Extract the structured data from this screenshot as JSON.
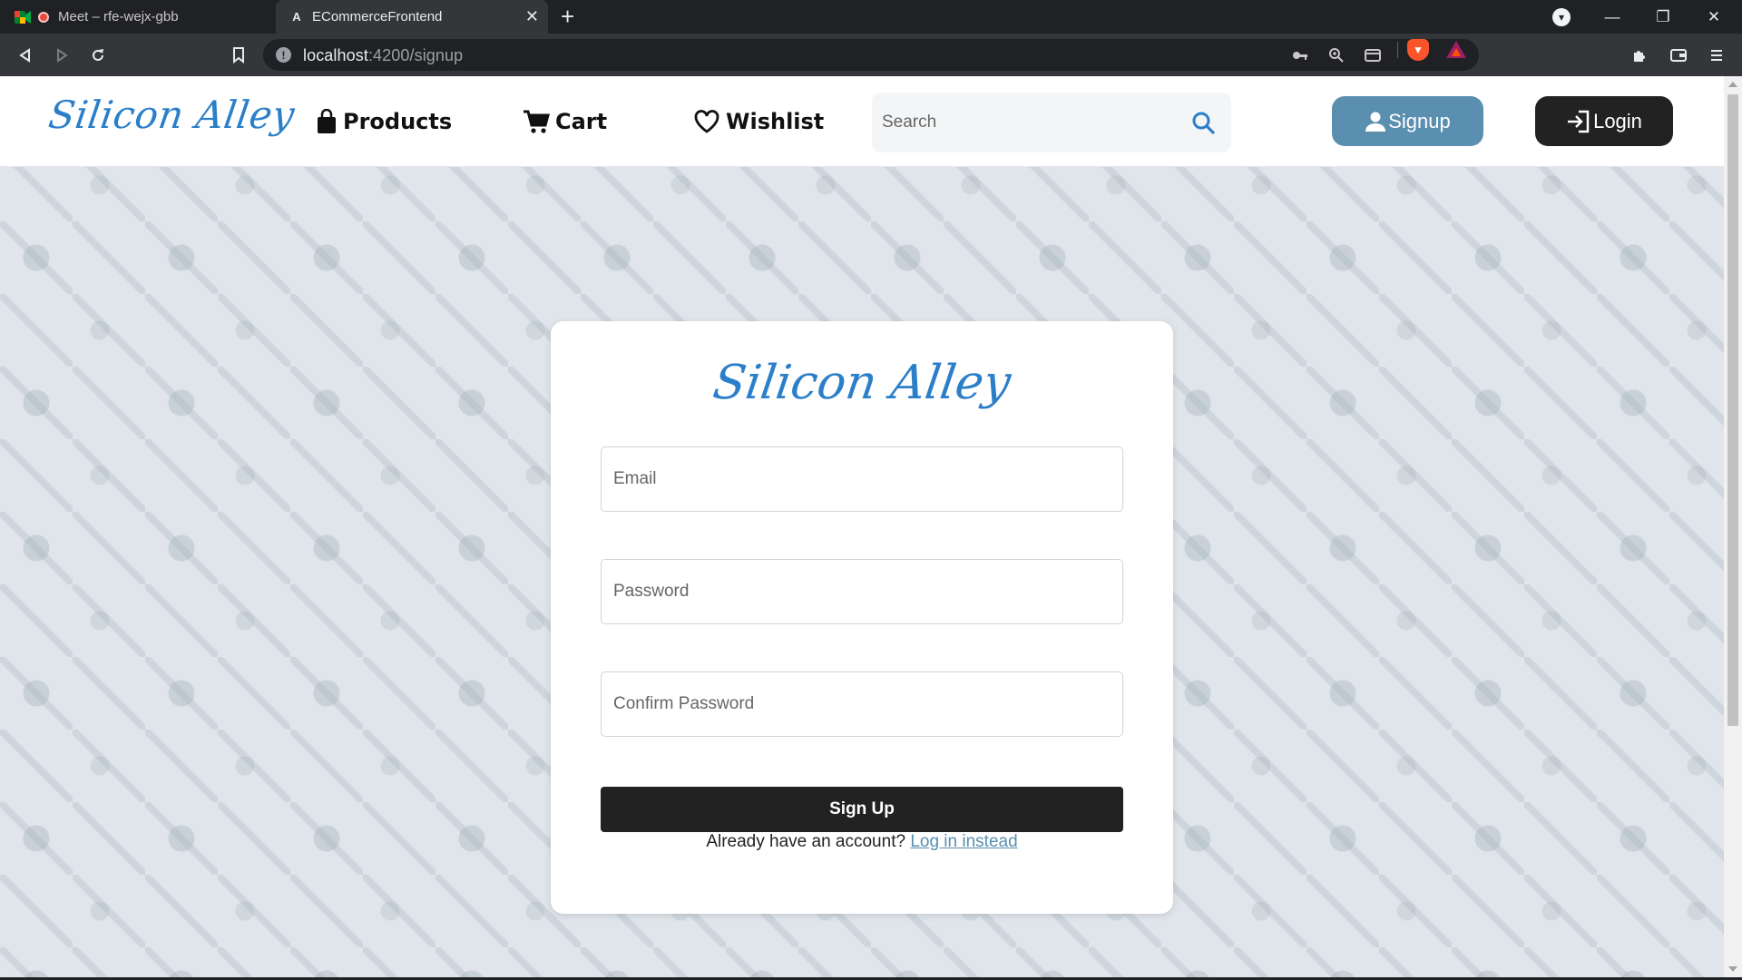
{
  "browser": {
    "tabs": [
      {
        "title": "Meet – rfe-wejx-gbb",
        "active": false
      },
      {
        "title": "ECommerceFrontend",
        "active": true
      }
    ],
    "url_host": "localhost",
    "url_path": ":4200/signup",
    "icons": [
      "back-icon",
      "forward-icon",
      "reload-icon",
      "bookmark-icon",
      "key-icon",
      "zoom-icon",
      "card-icon",
      "brave-shield-icon",
      "rewards-icon",
      "extensions-icon",
      "wallet-icon",
      "menu-icon"
    ]
  },
  "header": {
    "logo": "Silicon Alley",
    "nav": [
      {
        "label": "Products",
        "icon": "shopping-bag-icon"
      },
      {
        "label": "Cart",
        "icon": "cart-icon"
      },
      {
        "label": "Wishlist",
        "icon": "heart-icon"
      }
    ],
    "search_placeholder": "Search",
    "signup_label": "Signup",
    "login_label": "Login"
  },
  "signup": {
    "logo": "Silicon Alley",
    "email_placeholder": "Email",
    "password_placeholder": "Password",
    "confirm_placeholder": "Confirm Password",
    "submit_label": "Sign Up",
    "already_text": "Already have an account? ",
    "login_link": "Log in instead"
  },
  "colors": {
    "brand_blue": "#2b7fc9",
    "signup_button": "#5a8fb0",
    "dark_button": "#222222",
    "page_background": "#dfe5ea"
  }
}
